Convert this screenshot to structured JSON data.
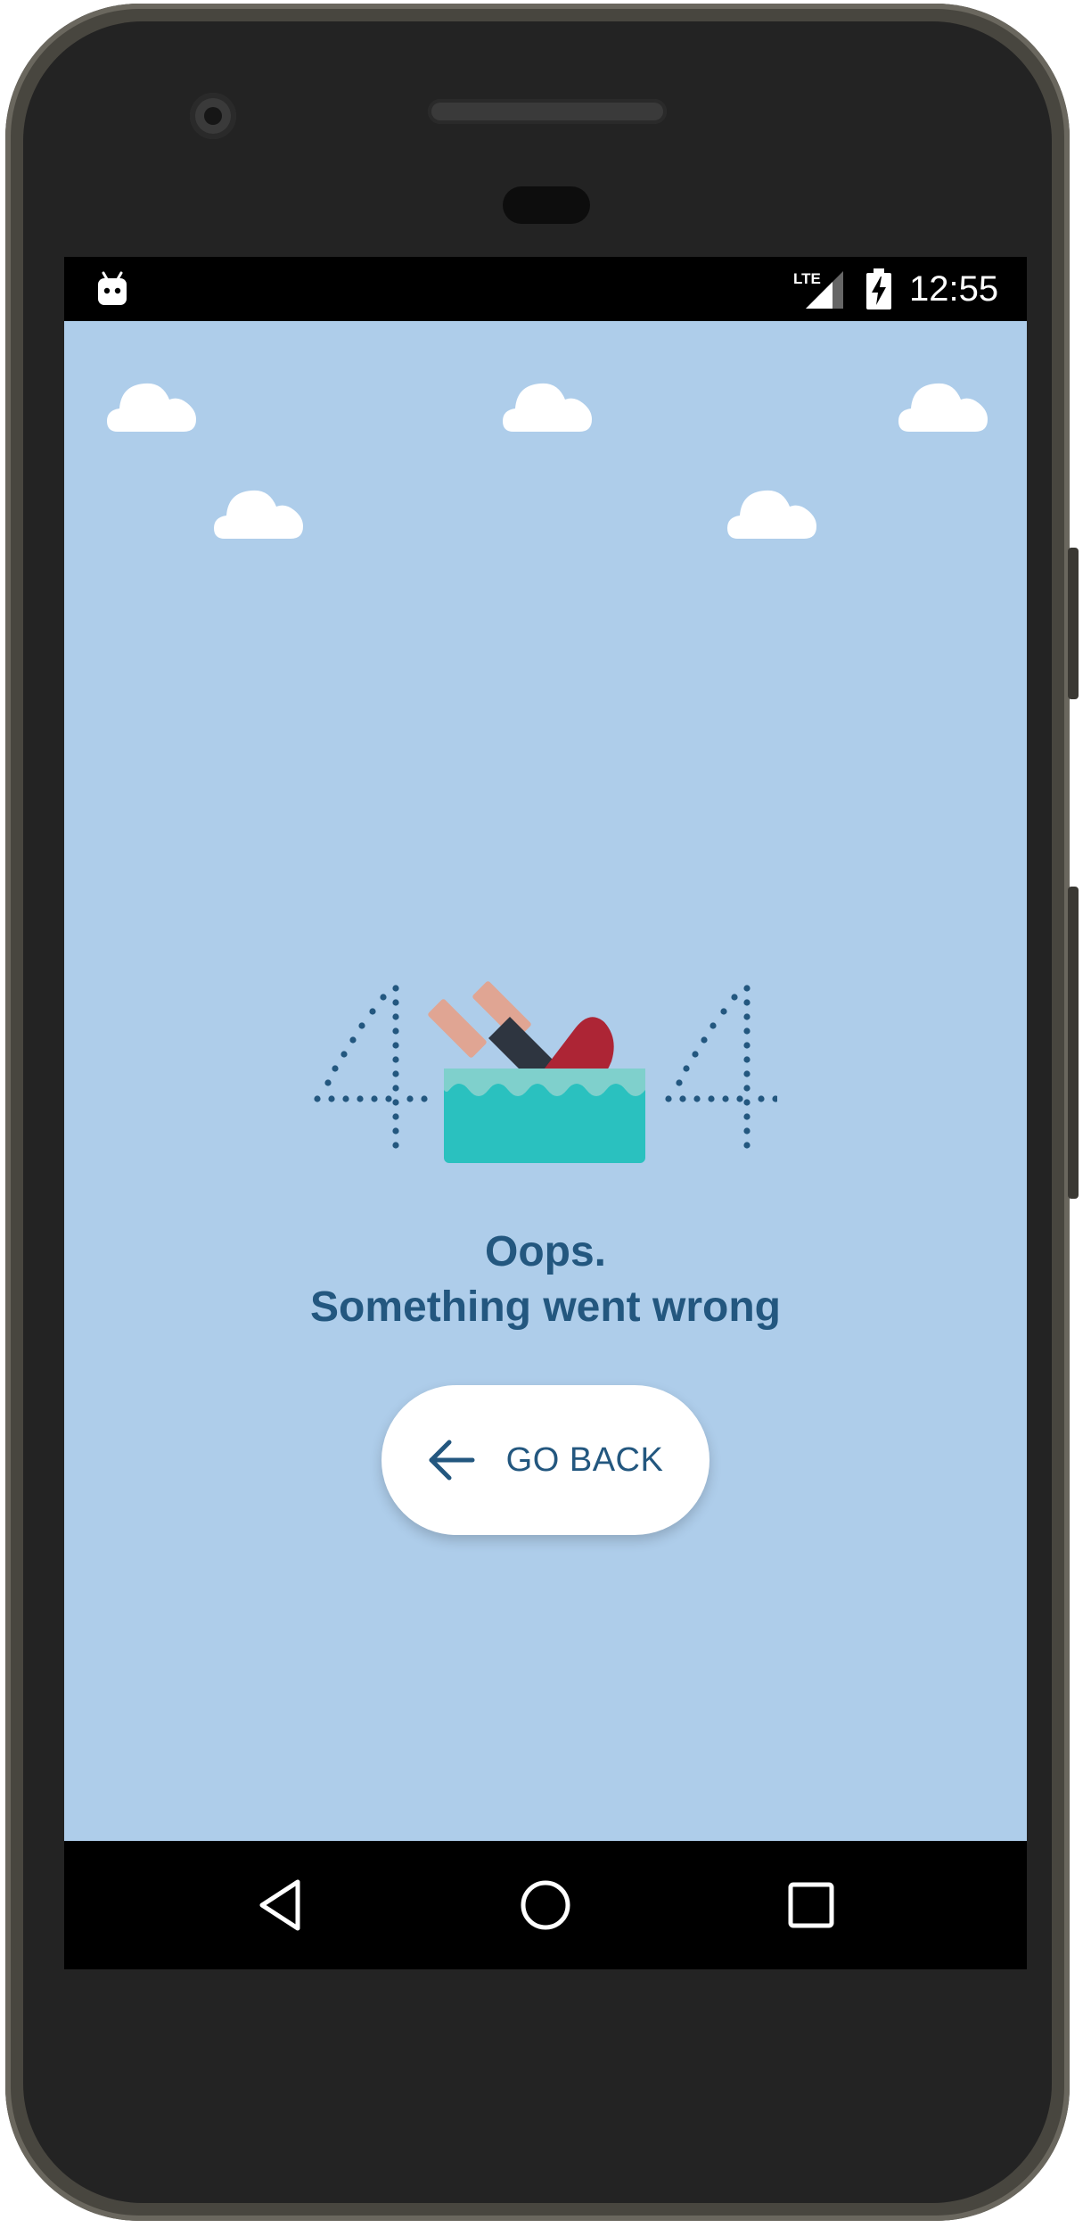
{
  "status_bar": {
    "time": "12:55",
    "network_label": "LTE",
    "icons": [
      "android-debug-icon",
      "lte-signal-icon",
      "battery-charging-icon"
    ]
  },
  "main": {
    "error_code_glyphs": [
      "4",
      "4"
    ],
    "title_line1": "Oops.",
    "title_line2": "Something went wrong",
    "go_back_label": "GO BACK",
    "go_back_icon": "arrow-left-icon"
  },
  "nav_bar": {
    "items": [
      "back-triangle-icon",
      "home-circle-icon",
      "recents-square-icon"
    ]
  },
  "colors": {
    "sky": "#aecdea",
    "text": "#23577f",
    "water": "#2ac1bf",
    "wave": "#7fd0cc",
    "ship_red": "#ad2535",
    "ship_dark": "#2e3540",
    "ship_pink": "#e0a593",
    "cloud": "#ffffff"
  }
}
